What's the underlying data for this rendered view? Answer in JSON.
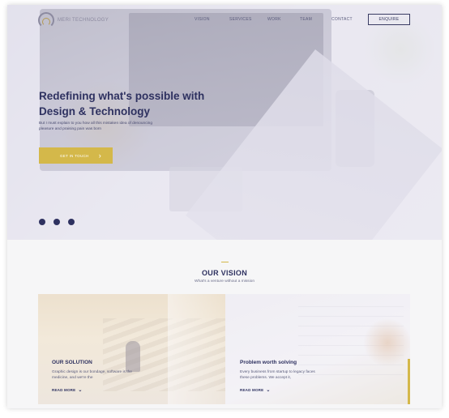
{
  "nav": {
    "logo_text": "MERI TECHNOLOGY",
    "links": [
      "VISION",
      "SERVICES",
      "WORK",
      "TEAM",
      "CONTACT"
    ],
    "enquire_label": "ENQUIRE"
  },
  "hero": {
    "title_line1": "Redefining what's possible with",
    "title_line2": "Design & Technology",
    "subtitle": "But I must explain to you how all this mistaken idea of denouncing pleasure and praising pain was born",
    "cta_label": "GET IN TOUCH",
    "slide_count": 3
  },
  "vision": {
    "title": "OUR VISION",
    "subtitle": "What's a venture without a mission",
    "cards": [
      {
        "title": "OUR SOLUTION",
        "text": "Graphic design is our bondage, software is the medicine, and we're the",
        "link": "READ MORE"
      },
      {
        "title": "Problem worth solving",
        "text": "Every business from startup to legacy faces these problems. We accept it,",
        "link": "READ MORE"
      }
    ]
  },
  "colors": {
    "primary": "#2e3160",
    "accent": "#d4b84a",
    "background": "#f6f6f7"
  }
}
